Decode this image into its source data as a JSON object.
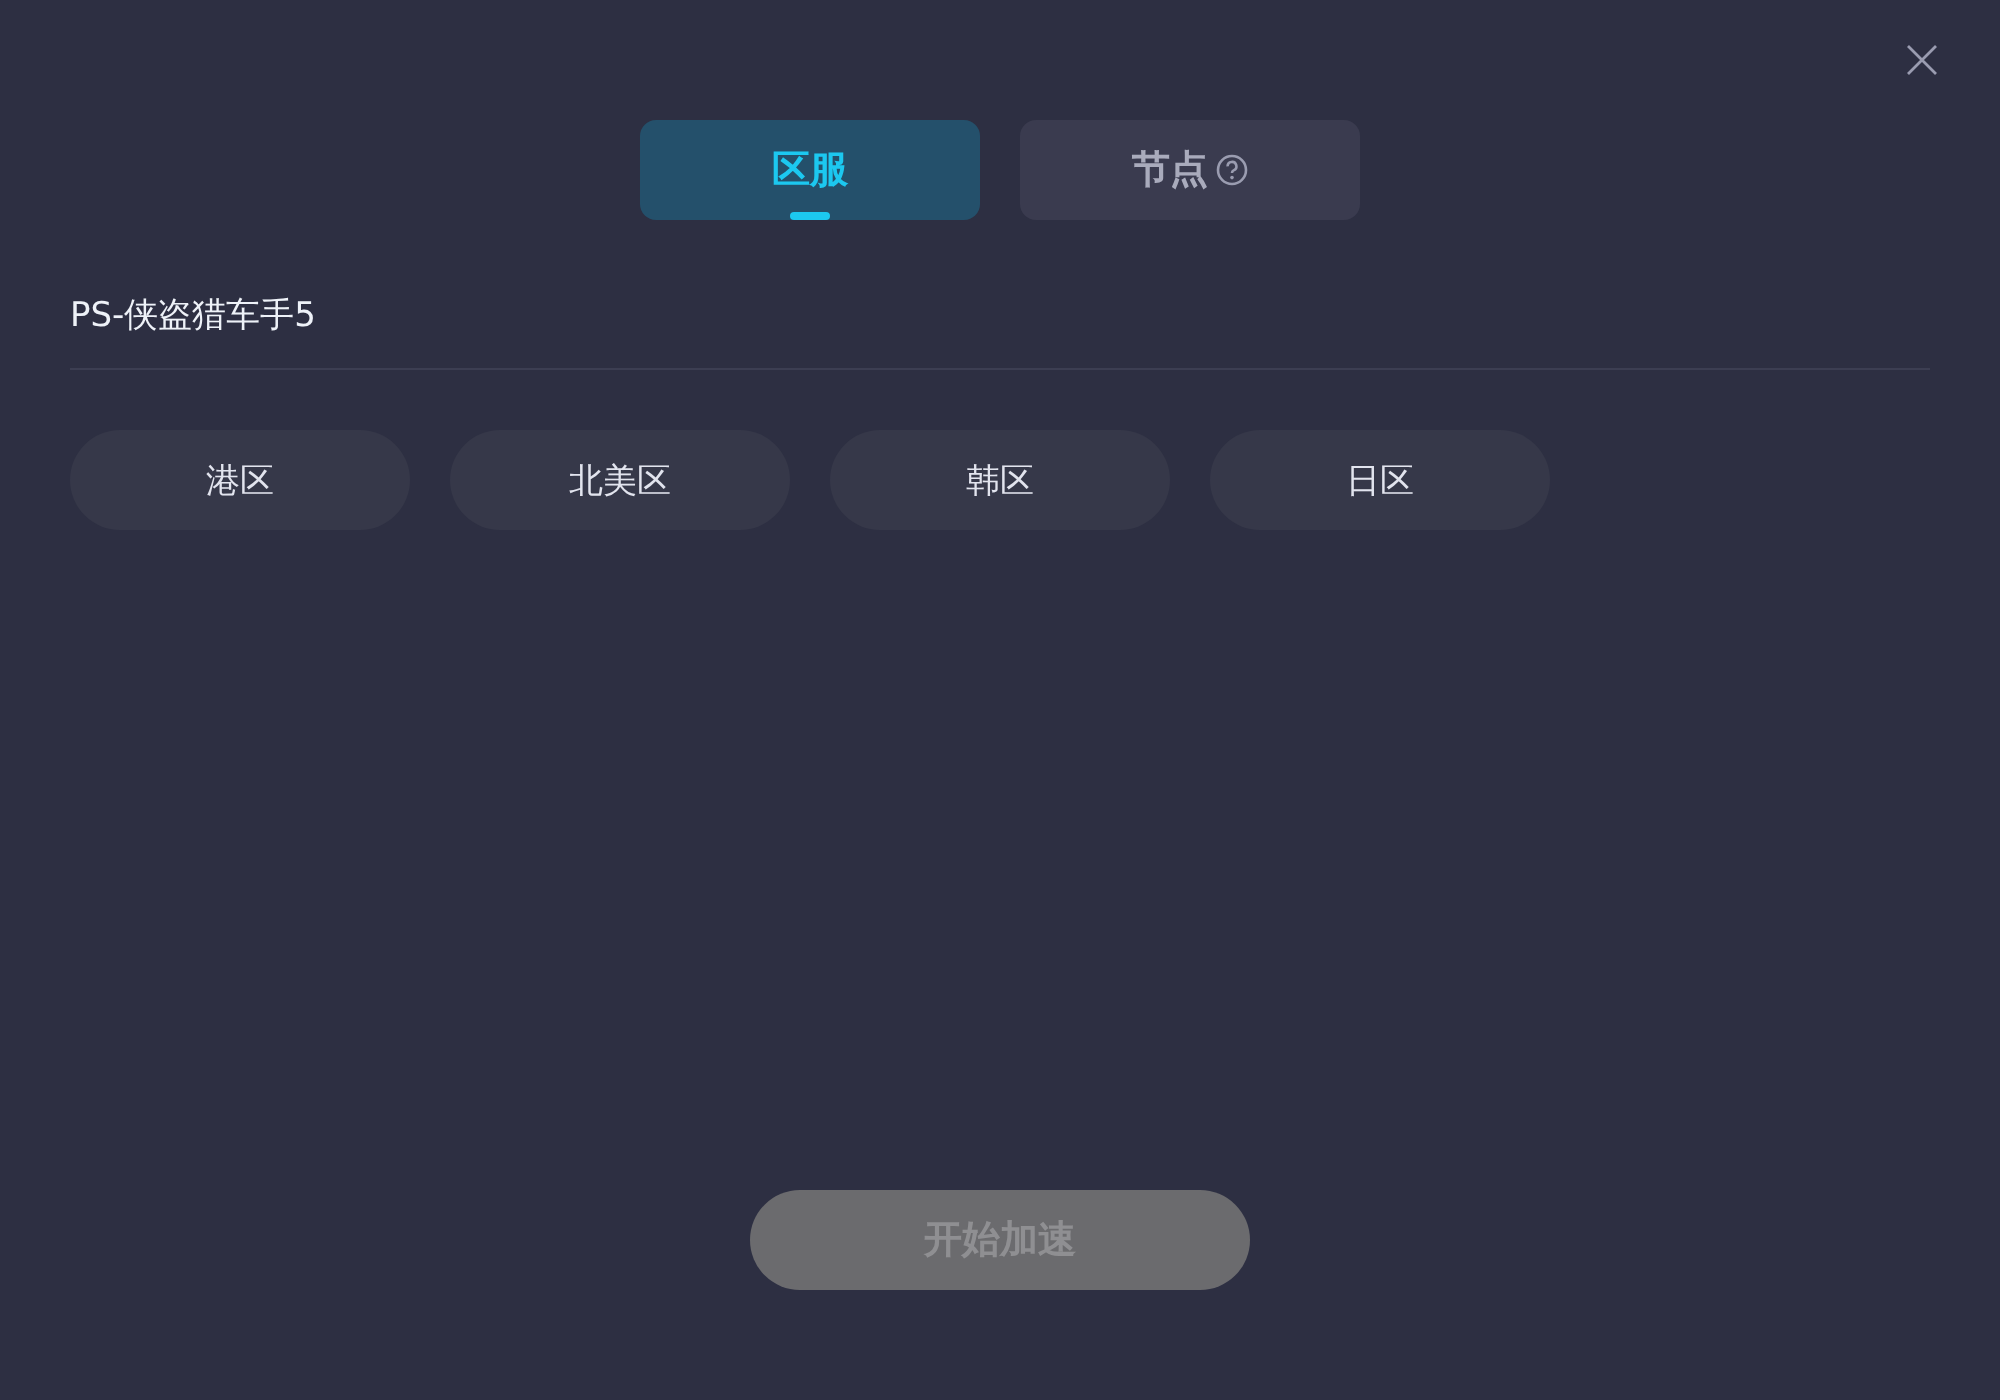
{
  "tabs": [
    {
      "label": "区服",
      "selected": true,
      "help": false
    },
    {
      "label": "节点",
      "selected": false,
      "help": true
    }
  ],
  "game_title": "PS-侠盗猎车手5",
  "regions": [
    {
      "label": "港区",
      "selected": false
    },
    {
      "label": "北美区",
      "selected": false
    },
    {
      "label": "韩区",
      "selected": false
    },
    {
      "label": "日区",
      "selected": false
    }
  ],
  "start_button": {
    "label": "开始加速",
    "disabled": true
  }
}
